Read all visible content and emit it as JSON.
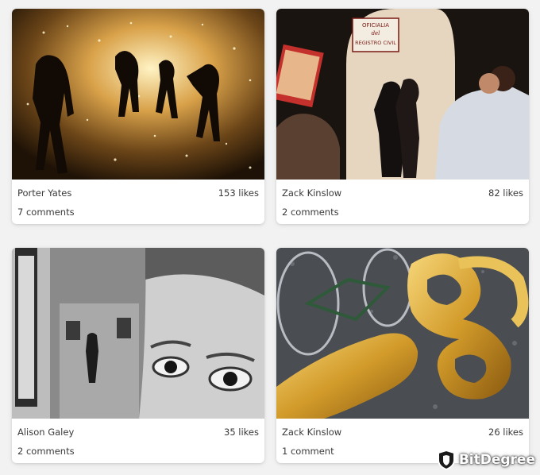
{
  "cards": [
    {
      "author": "Porter Yates",
      "likes": "153 likes",
      "comments": "7 comments",
      "image": "fireworks-crowd-night-photo"
    },
    {
      "author": "Zack Kinslow",
      "likes": "82 likes",
      "comments": "2 comments",
      "image": "registro-civil-couple-photo"
    },
    {
      "author": "Alison Galey",
      "likes": "35 likes",
      "comments": "2 comments",
      "image": "gallery-mural-eyes-bw-photo"
    },
    {
      "author": "Zack Kinslow",
      "likes": "26 likes",
      "comments": "1 comment",
      "image": "gold-balloons-bicycle-photo"
    }
  ],
  "photo_signs": {
    "oficialia": "OFICIALIA",
    "del": "del",
    "registro": "REGISTRO CIVIL"
  },
  "watermark": {
    "brand": "BitDegree",
    "icon": "shield-logo-icon"
  }
}
